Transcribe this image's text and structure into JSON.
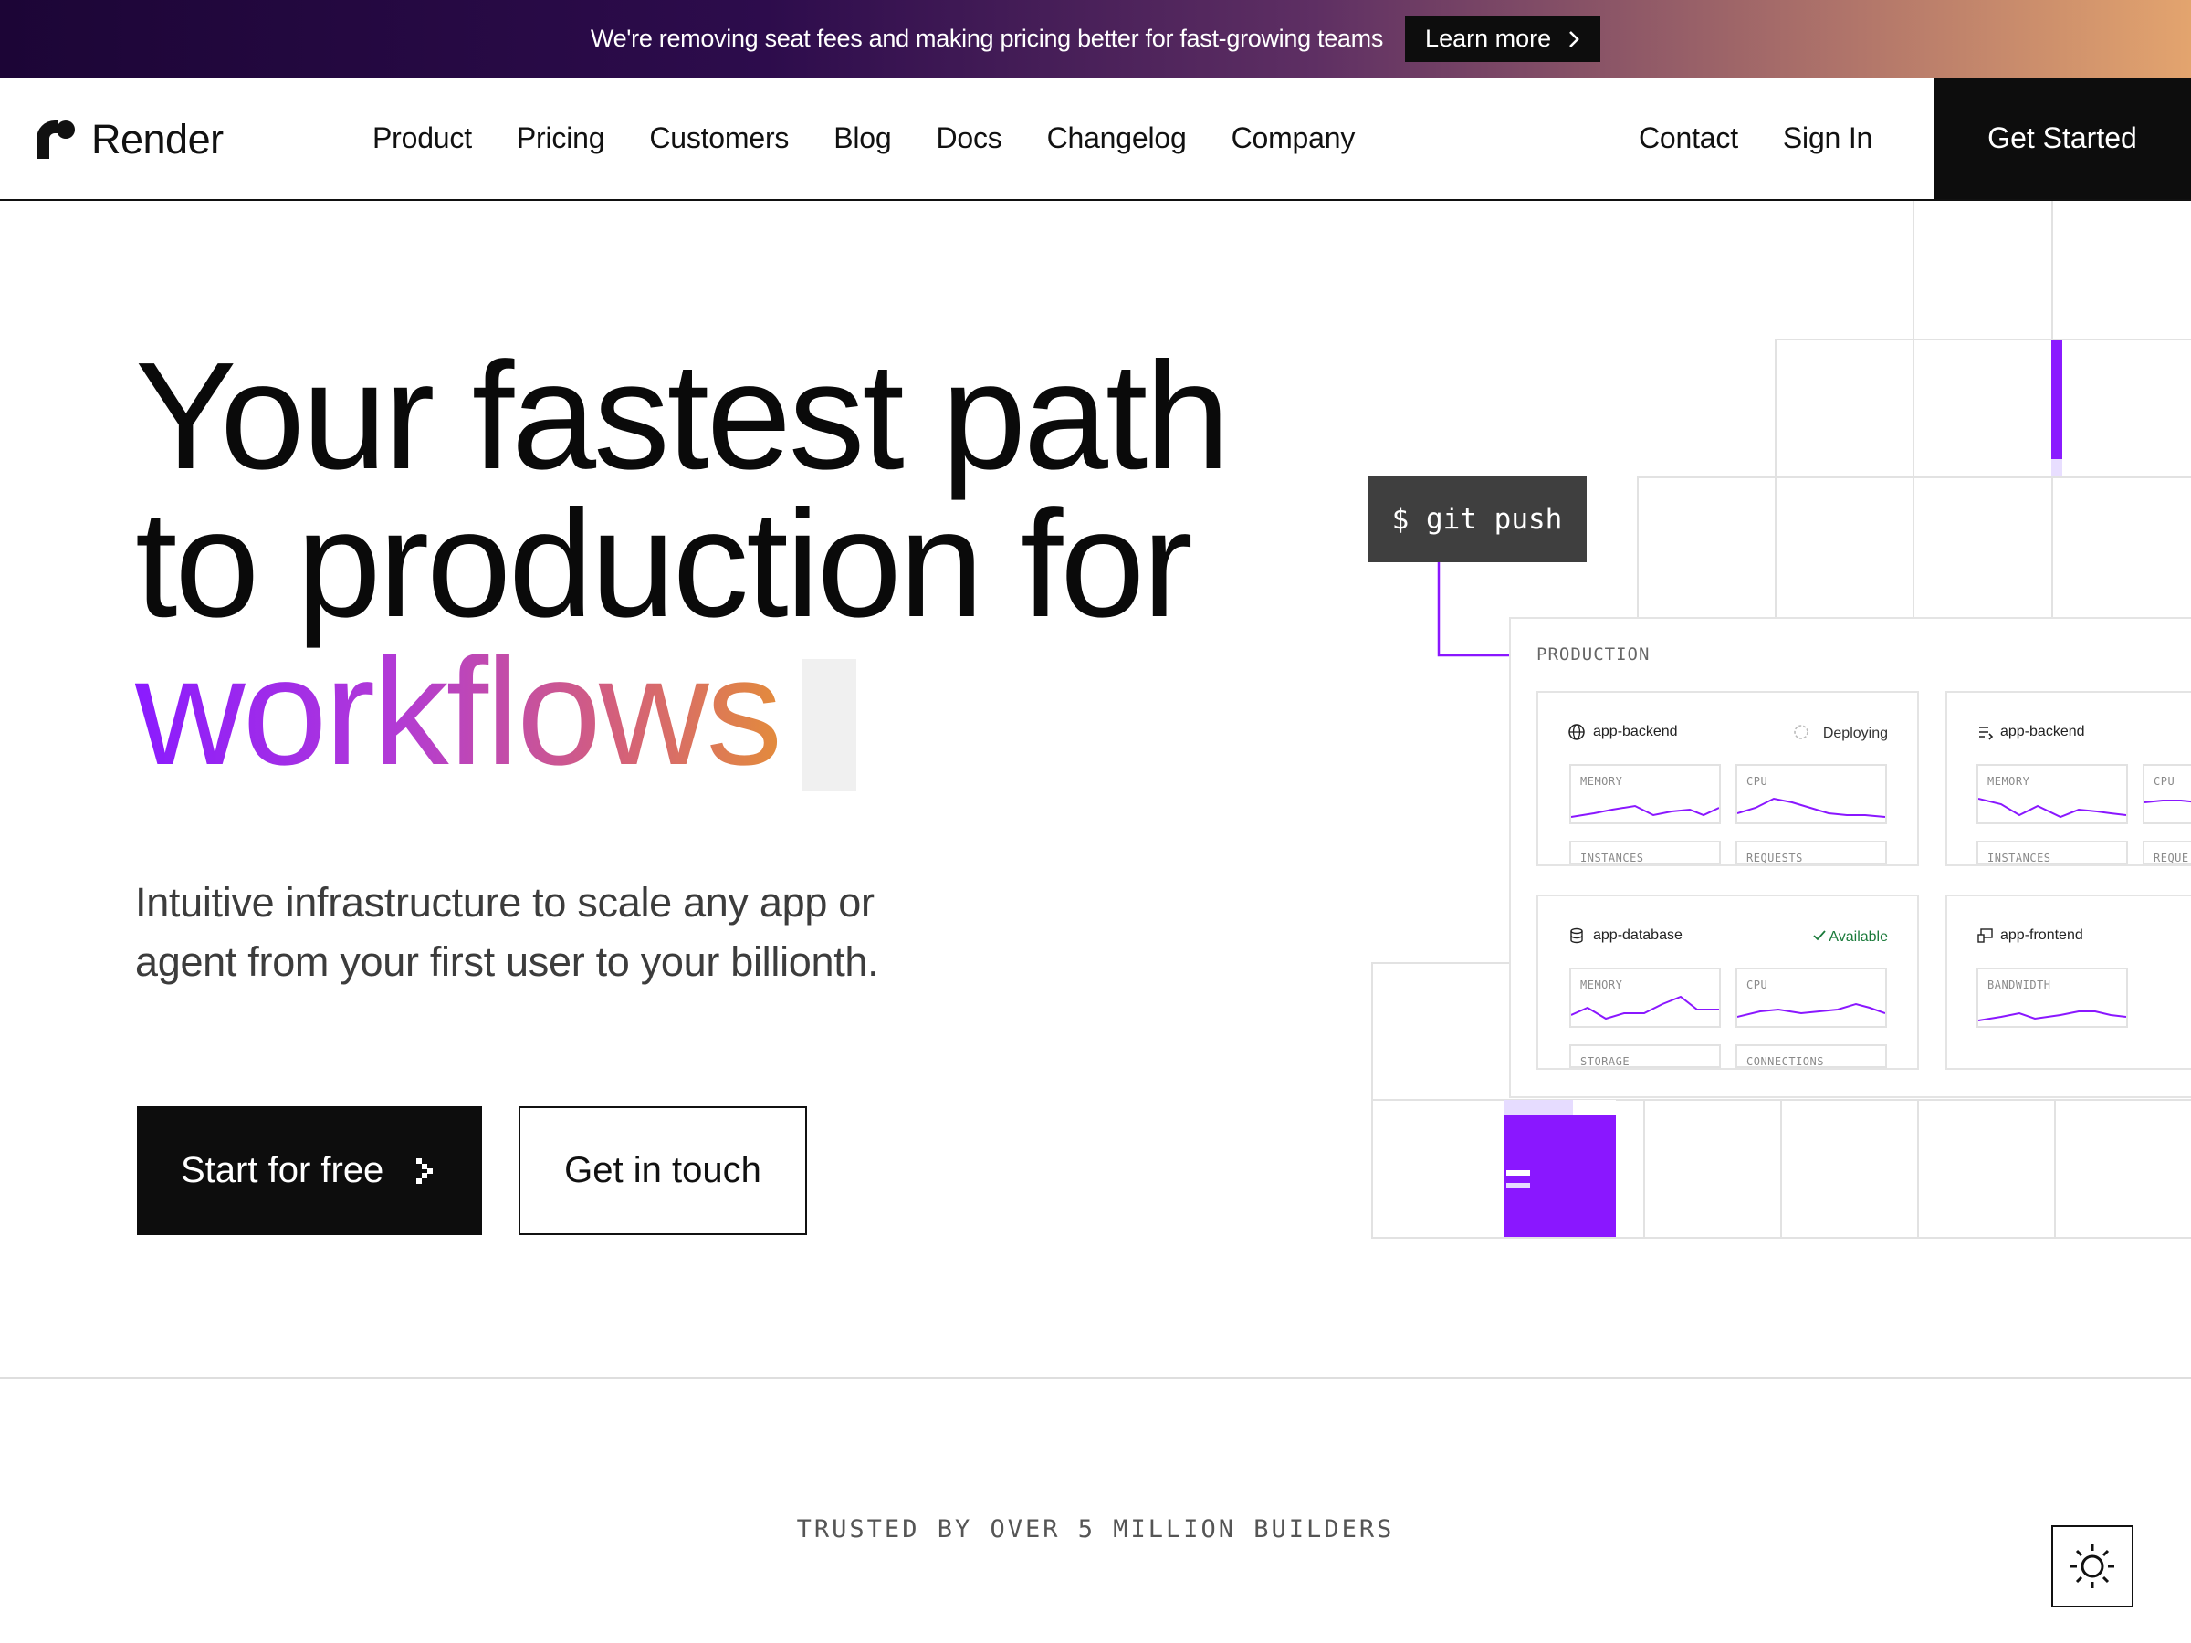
{
  "banner": {
    "text": "We're removing seat fees and making pricing better for fast-growing teams",
    "cta": "Learn more"
  },
  "header": {
    "logo": "Render",
    "nav": [
      "Product",
      "Pricing",
      "Customers",
      "Blog",
      "Docs",
      "Changelog",
      "Company"
    ],
    "contact": "Contact",
    "sign_in": "Sign In",
    "get_started": "Get Started"
  },
  "hero": {
    "title_line1": "Your fastest path",
    "title_line2": "to production for",
    "title_highlight": "workflows",
    "subtitle_line1": "Intuitive infrastructure to scale any app or",
    "subtitle_line2": "agent from your first user to your billionth.",
    "primary_cta": "Start for free",
    "secondary_cta": "Get in touch"
  },
  "illustration": {
    "command": "$ git push",
    "env_label": "PRODUCTION",
    "services": [
      {
        "name": "app-backend",
        "icon": "globe-icon",
        "status": "Deploying",
        "metrics": [
          "MEMORY",
          "CPU",
          "INSTANCES",
          "REQUESTS"
        ]
      },
      {
        "name": "app-backend",
        "icon": "worker-icon",
        "status": "",
        "metrics": [
          "MEMORY",
          "CPU",
          "INSTANCES",
          "REQUE"
        ]
      },
      {
        "name": "app-database",
        "icon": "database-icon",
        "status": "Available",
        "metrics": [
          "MEMORY",
          "CPU",
          "STORAGE",
          "CONNECTIONS"
        ]
      },
      {
        "name": "app-frontend",
        "icon": "static-site-icon",
        "status": "",
        "metrics": [
          "BANDWIDTH"
        ]
      }
    ],
    "colors": {
      "accent": "#8a17ff",
      "available": "#1a7a3a"
    }
  },
  "trust": {
    "label": "TRUSTED BY OVER 5 MILLION BUILDERS"
  },
  "theme_toggle": {
    "icon": "sun-icon"
  }
}
